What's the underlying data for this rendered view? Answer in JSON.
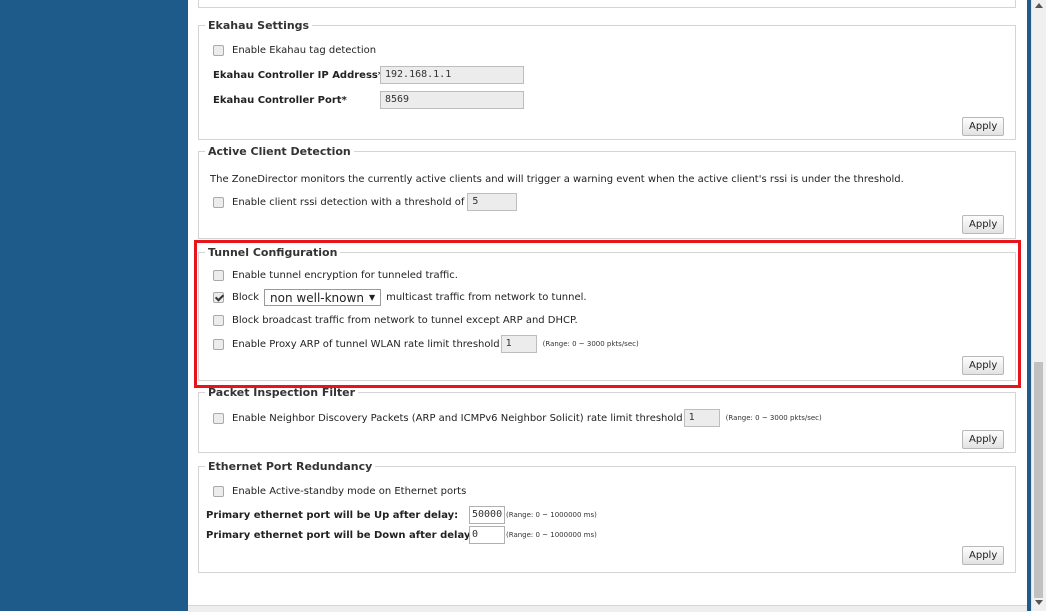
{
  "colors": {
    "left_panel": "#1e5a8a",
    "highlight_border": "#e8141b"
  },
  "ekahau": {
    "title": "Ekahau Settings",
    "enable_label": "Enable Ekahau tag detection",
    "ip_label": "Ekahau Controller IP Address*",
    "ip_value": "192.168.1.1",
    "port_label": "Ekahau Controller Port*",
    "port_value": "8569",
    "apply_label": "Apply"
  },
  "active_client": {
    "title": "Active Client Detection",
    "description": "The ZoneDirector monitors the currently active clients and will trigger a warning event when the active client's rssi is under the threshold.",
    "enable_label": "Enable client rssi detection with a threshold of",
    "threshold_value": "5",
    "apply_label": "Apply"
  },
  "tunnel": {
    "title": "Tunnel Configuration",
    "encryption_label": "Enable tunnel encryption for tunneled traffic.",
    "block_prefix": "Block",
    "block_select_value": "non well-known",
    "block_suffix": "multicast traffic from network to tunnel.",
    "broadcast_label": "Block broadcast traffic from network to tunnel except ARP and DHCP.",
    "proxy_label": "Enable Proxy ARP of tunnel WLAN rate limit threshold",
    "proxy_value": "1",
    "proxy_range": "(Range: 0 ~ 3000 pkts/sec)",
    "apply_label": "Apply"
  },
  "packet_inspection": {
    "title": "Packet Inspection Filter",
    "enable_label": "Enable Neighbor Discovery Packets (ARP and ICMPv6 Neighbor Solicit) rate limit threshold",
    "threshold_value": "1",
    "range": "(Range: 0 ~ 3000 pkts/sec)",
    "apply_label": "Apply"
  },
  "ethernet": {
    "title": "Ethernet Port Redundancy",
    "enable_label": "Enable Active-standby mode on Ethernet ports",
    "up_label": "Primary ethernet port will be Up after delay:",
    "up_value": "50000",
    "up_range": "(Range: 0 ~ 1000000 ms)",
    "down_label": "Primary ethernet port will be Down after delay:",
    "down_value": "0",
    "down_range": "(Range: 0 ~ 1000000 ms)",
    "apply_label": "Apply"
  }
}
